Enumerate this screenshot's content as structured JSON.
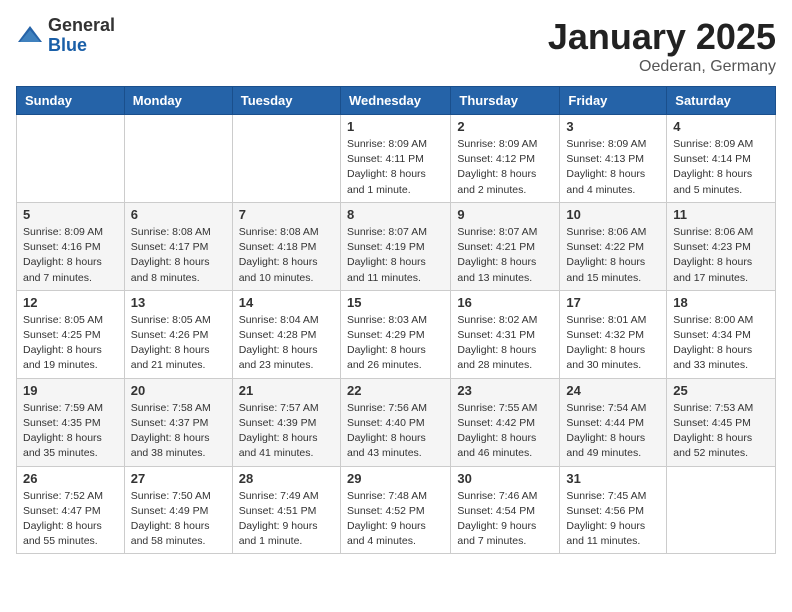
{
  "logo": {
    "general": "General",
    "blue": "Blue"
  },
  "header": {
    "month": "January 2025",
    "location": "Oederan, Germany"
  },
  "weekdays": [
    "Sunday",
    "Monday",
    "Tuesday",
    "Wednesday",
    "Thursday",
    "Friday",
    "Saturday"
  ],
  "weeks": [
    [
      null,
      null,
      null,
      {
        "day": "1",
        "sunrise": "Sunrise: 8:09 AM",
        "sunset": "Sunset: 4:11 PM",
        "daylight": "Daylight: 8 hours and 1 minute."
      },
      {
        "day": "2",
        "sunrise": "Sunrise: 8:09 AM",
        "sunset": "Sunset: 4:12 PM",
        "daylight": "Daylight: 8 hours and 2 minutes."
      },
      {
        "day": "3",
        "sunrise": "Sunrise: 8:09 AM",
        "sunset": "Sunset: 4:13 PM",
        "daylight": "Daylight: 8 hours and 4 minutes."
      },
      {
        "day": "4",
        "sunrise": "Sunrise: 8:09 AM",
        "sunset": "Sunset: 4:14 PM",
        "daylight": "Daylight: 8 hours and 5 minutes."
      }
    ],
    [
      {
        "day": "5",
        "sunrise": "Sunrise: 8:09 AM",
        "sunset": "Sunset: 4:16 PM",
        "daylight": "Daylight: 8 hours and 7 minutes."
      },
      {
        "day": "6",
        "sunrise": "Sunrise: 8:08 AM",
        "sunset": "Sunset: 4:17 PM",
        "daylight": "Daylight: 8 hours and 8 minutes."
      },
      {
        "day": "7",
        "sunrise": "Sunrise: 8:08 AM",
        "sunset": "Sunset: 4:18 PM",
        "daylight": "Daylight: 8 hours and 10 minutes."
      },
      {
        "day": "8",
        "sunrise": "Sunrise: 8:07 AM",
        "sunset": "Sunset: 4:19 PM",
        "daylight": "Daylight: 8 hours and 11 minutes."
      },
      {
        "day": "9",
        "sunrise": "Sunrise: 8:07 AM",
        "sunset": "Sunset: 4:21 PM",
        "daylight": "Daylight: 8 hours and 13 minutes."
      },
      {
        "day": "10",
        "sunrise": "Sunrise: 8:06 AM",
        "sunset": "Sunset: 4:22 PM",
        "daylight": "Daylight: 8 hours and 15 minutes."
      },
      {
        "day": "11",
        "sunrise": "Sunrise: 8:06 AM",
        "sunset": "Sunset: 4:23 PM",
        "daylight": "Daylight: 8 hours and 17 minutes."
      }
    ],
    [
      {
        "day": "12",
        "sunrise": "Sunrise: 8:05 AM",
        "sunset": "Sunset: 4:25 PM",
        "daylight": "Daylight: 8 hours and 19 minutes."
      },
      {
        "day": "13",
        "sunrise": "Sunrise: 8:05 AM",
        "sunset": "Sunset: 4:26 PM",
        "daylight": "Daylight: 8 hours and 21 minutes."
      },
      {
        "day": "14",
        "sunrise": "Sunrise: 8:04 AM",
        "sunset": "Sunset: 4:28 PM",
        "daylight": "Daylight: 8 hours and 23 minutes."
      },
      {
        "day": "15",
        "sunrise": "Sunrise: 8:03 AM",
        "sunset": "Sunset: 4:29 PM",
        "daylight": "Daylight: 8 hours and 26 minutes."
      },
      {
        "day": "16",
        "sunrise": "Sunrise: 8:02 AM",
        "sunset": "Sunset: 4:31 PM",
        "daylight": "Daylight: 8 hours and 28 minutes."
      },
      {
        "day": "17",
        "sunrise": "Sunrise: 8:01 AM",
        "sunset": "Sunset: 4:32 PM",
        "daylight": "Daylight: 8 hours and 30 minutes."
      },
      {
        "day": "18",
        "sunrise": "Sunrise: 8:00 AM",
        "sunset": "Sunset: 4:34 PM",
        "daylight": "Daylight: 8 hours and 33 minutes."
      }
    ],
    [
      {
        "day": "19",
        "sunrise": "Sunrise: 7:59 AM",
        "sunset": "Sunset: 4:35 PM",
        "daylight": "Daylight: 8 hours and 35 minutes."
      },
      {
        "day": "20",
        "sunrise": "Sunrise: 7:58 AM",
        "sunset": "Sunset: 4:37 PM",
        "daylight": "Daylight: 8 hours and 38 minutes."
      },
      {
        "day": "21",
        "sunrise": "Sunrise: 7:57 AM",
        "sunset": "Sunset: 4:39 PM",
        "daylight": "Daylight: 8 hours and 41 minutes."
      },
      {
        "day": "22",
        "sunrise": "Sunrise: 7:56 AM",
        "sunset": "Sunset: 4:40 PM",
        "daylight": "Daylight: 8 hours and 43 minutes."
      },
      {
        "day": "23",
        "sunrise": "Sunrise: 7:55 AM",
        "sunset": "Sunset: 4:42 PM",
        "daylight": "Daylight: 8 hours and 46 minutes."
      },
      {
        "day": "24",
        "sunrise": "Sunrise: 7:54 AM",
        "sunset": "Sunset: 4:44 PM",
        "daylight": "Daylight: 8 hours and 49 minutes."
      },
      {
        "day": "25",
        "sunrise": "Sunrise: 7:53 AM",
        "sunset": "Sunset: 4:45 PM",
        "daylight": "Daylight: 8 hours and 52 minutes."
      }
    ],
    [
      {
        "day": "26",
        "sunrise": "Sunrise: 7:52 AM",
        "sunset": "Sunset: 4:47 PM",
        "daylight": "Daylight: 8 hours and 55 minutes."
      },
      {
        "day": "27",
        "sunrise": "Sunrise: 7:50 AM",
        "sunset": "Sunset: 4:49 PM",
        "daylight": "Daylight: 8 hours and 58 minutes."
      },
      {
        "day": "28",
        "sunrise": "Sunrise: 7:49 AM",
        "sunset": "Sunset: 4:51 PM",
        "daylight": "Daylight: 9 hours and 1 minute."
      },
      {
        "day": "29",
        "sunrise": "Sunrise: 7:48 AM",
        "sunset": "Sunset: 4:52 PM",
        "daylight": "Daylight: 9 hours and 4 minutes."
      },
      {
        "day": "30",
        "sunrise": "Sunrise: 7:46 AM",
        "sunset": "Sunset: 4:54 PM",
        "daylight": "Daylight: 9 hours and 7 minutes."
      },
      {
        "day": "31",
        "sunrise": "Sunrise: 7:45 AM",
        "sunset": "Sunset: 4:56 PM",
        "daylight": "Daylight: 9 hours and 11 minutes."
      },
      null
    ]
  ]
}
